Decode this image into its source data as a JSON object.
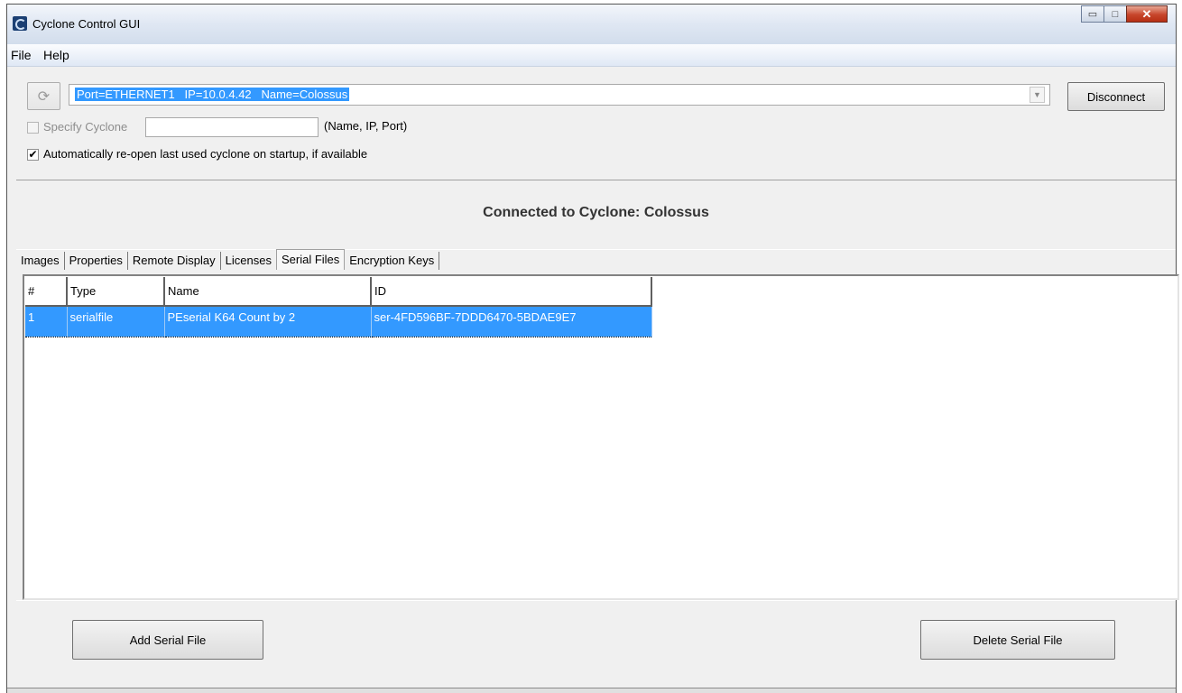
{
  "window": {
    "title": "Cyclone Control GUI",
    "icon": "cyclone-app-icon",
    "caption_buttons": {
      "minimize": "▭",
      "maximize": "□",
      "close": "✕"
    }
  },
  "menu": {
    "items": [
      "File",
      "Help"
    ]
  },
  "connection": {
    "refresh_icon": "refresh-icon",
    "selected": "Port=ETHERNET1   IP=10.0.4.42   Name=Colossus",
    "dropdown_arrow": "▼",
    "disconnect_label": "Disconnect",
    "specify_cyclone_label": "Specify Cyclone",
    "specify_cyclone_value": "",
    "specify_hint": "(Name, IP, Port)",
    "auto_reopen_label": "Automatically re-open last used cyclone on startup, if available",
    "auto_reopen_checked": "✔"
  },
  "status": {
    "text": "Connected to Cyclone: Colossus"
  },
  "tabs": [
    "Images",
    "Properties",
    "Remote Display",
    "Licenses",
    "Serial Files",
    "Encryption Keys"
  ],
  "active_tab": "Serial Files",
  "table": {
    "columns": [
      "#",
      "Type",
      "Name",
      "ID"
    ],
    "rows": [
      [
        "1",
        "serialfile",
        "PEserial K64 Count by 2",
        "ser-4FD596BF-7DDD6470-5BDAE9E7"
      ]
    ]
  },
  "buttons": {
    "add": "Add Serial File",
    "delete": "Delete Serial File"
  },
  "colors": {
    "selection": "#3399ff",
    "window_bg": "#f0f0f0"
  }
}
